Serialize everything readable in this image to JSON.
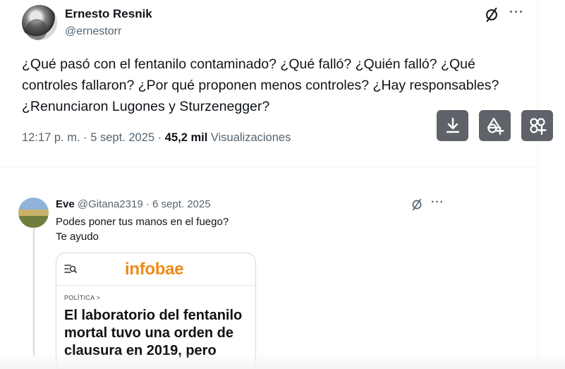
{
  "tweet": {
    "author_name": "Ernesto Resnik",
    "author_handle": "@ernestorr",
    "text": "¿Qué pasó con el fentanilo contaminado? ¿Qué falló? ¿Quién falló? ¿Qué controles fallaron? ¿Por qué proponen menos controles? ¿Hay responsables? ¿Renunciaron Lugones y Sturzenegger?",
    "time": "12:17 p. m.",
    "dot": "·",
    "date": "5 sept. 2025",
    "views_count": "45,2 mil",
    "views_label": "Visualizaciones",
    "more_label": "···",
    "icons": [
      "grok-icon",
      "more-icon",
      "download-icon",
      "shapes-add-icon",
      "pinwheel-add-icon"
    ],
    "action_button_color": "#5f6268"
  },
  "reply": {
    "author_name": "Eve",
    "author_handle": "@Gitana2319",
    "dot": "·",
    "date": "6 sept. 2025",
    "more_label": "···",
    "line1": "Podes poner tus manos en el fuego?",
    "line2": "Te ayudo",
    "card": {
      "brand": "infobae",
      "brand_color": "#f08a16",
      "kicker": "POLÍTICA >",
      "headline": "El laboratorio del fentanilo mortal tuvo una orden de clausura en 2019, pero"
    }
  }
}
